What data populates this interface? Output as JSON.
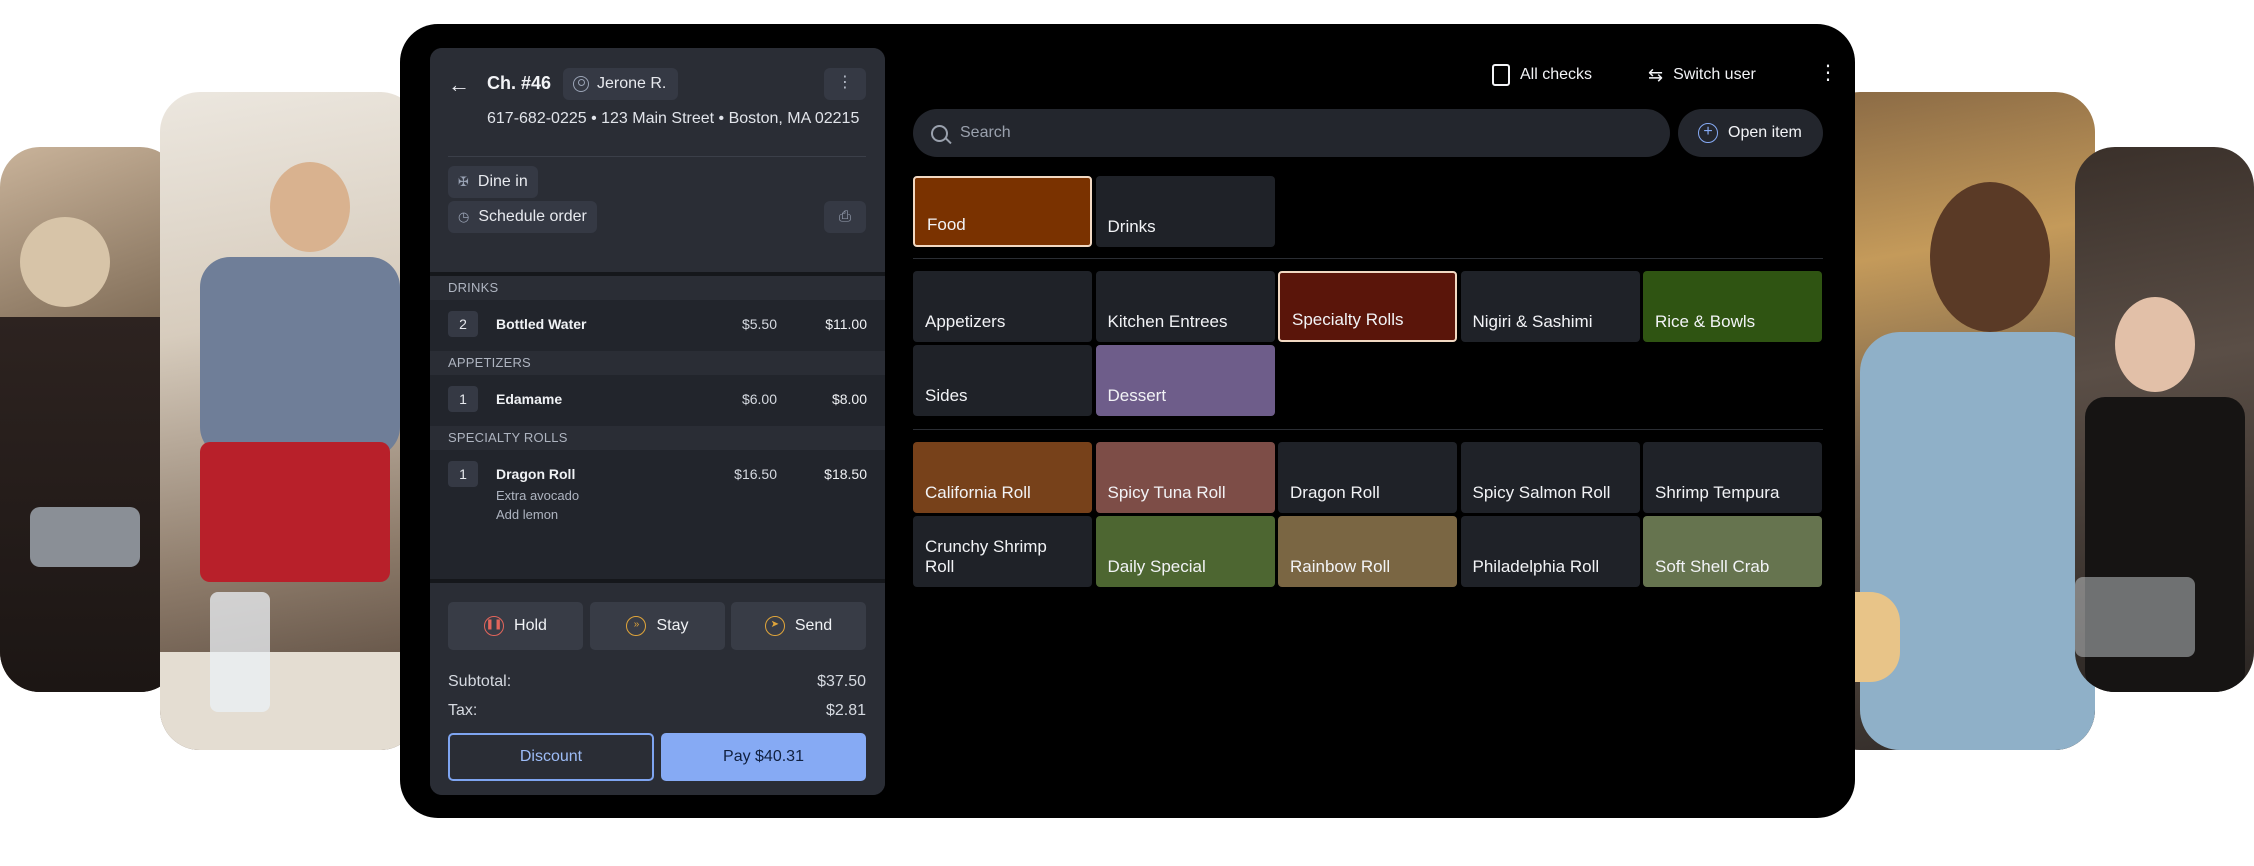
{
  "order": {
    "back_icon": "arrow-left-icon",
    "check_number": "Ch. #46",
    "server": "Jerone R.",
    "address_line": "617-682-0225 • 123 Main Street • Boston, MA 02215",
    "dine_in": "Dine in",
    "schedule": "Schedule order",
    "sections": [
      {
        "title": "DRINKS",
        "items": [
          {
            "qty": "2",
            "name": "Bottled Water",
            "unit": "$5.50",
            "total": "$11.00",
            "mods": []
          }
        ]
      },
      {
        "title": "APPETIZERS",
        "items": [
          {
            "qty": "1",
            "name": "Edamame",
            "unit": "$6.00",
            "total": "$8.00",
            "mods": []
          }
        ]
      },
      {
        "title": "SPECIALTY ROLLS",
        "items": [
          {
            "qty": "1",
            "name": "Dragon Roll",
            "unit": "$16.50",
            "total": "$18.50",
            "mods": [
              "Extra avocado",
              "Add lemon"
            ]
          }
        ]
      }
    ],
    "actions": {
      "hold": "Hold",
      "stay": "Stay",
      "send": "Send"
    },
    "subtotal_label": "Subtotal:",
    "subtotal_value": "$37.50",
    "tax_label": "Tax:",
    "tax_value": "$2.81",
    "discount_label": "Discount",
    "pay_label": "Pay $40.31"
  },
  "topbar": {
    "all_checks": "All checks",
    "switch_user": "Switch user"
  },
  "search": {
    "placeholder": "Search",
    "open_item": "Open item"
  },
  "menu": {
    "groups": [
      {
        "label": "Food",
        "color": "#7a3200",
        "selected": true
      },
      {
        "label": "Drinks",
        "color": "#1f2228",
        "selected": false
      }
    ],
    "categories": [
      {
        "label": "Appetizers",
        "color": "#1f2228",
        "selected": false
      },
      {
        "label": "Kitchen Entrees",
        "color": "#1f2228",
        "selected": false
      },
      {
        "label": "Specialty Rolls",
        "color": "#5a150a",
        "selected": true
      },
      {
        "label": "Nigiri & Sashimi",
        "color": "#1f2228",
        "selected": false
      },
      {
        "label": "Rice & Bowls",
        "color": "#2f5412",
        "selected": false
      },
      {
        "label": "Sides",
        "color": "#1f2228",
        "selected": false
      },
      {
        "label": "Dessert",
        "color": "#6e5d8a",
        "selected": false
      }
    ],
    "items": [
      {
        "label": "California Roll",
        "color": "#77411a"
      },
      {
        "label": "Spicy Tuna Roll",
        "color": "#7d4d47"
      },
      {
        "label": "Dragon Roll",
        "color": "#1f2228"
      },
      {
        "label": "Spicy Salmon Roll",
        "color": "#1f2228"
      },
      {
        "label": "Shrimp Tempura",
        "color": "#1f2228"
      },
      {
        "label": "Crunchy Shrimp Roll",
        "color": "#1f2228"
      },
      {
        "label": "Daily Special",
        "color": "#4d6631"
      },
      {
        "label": "Rainbow Roll",
        "color": "#7a6643"
      },
      {
        "label": "Philadelphia Roll",
        "color": "#1f2228"
      },
      {
        "label": "Soft Shell Crab",
        "color": "#66744f"
      }
    ]
  }
}
